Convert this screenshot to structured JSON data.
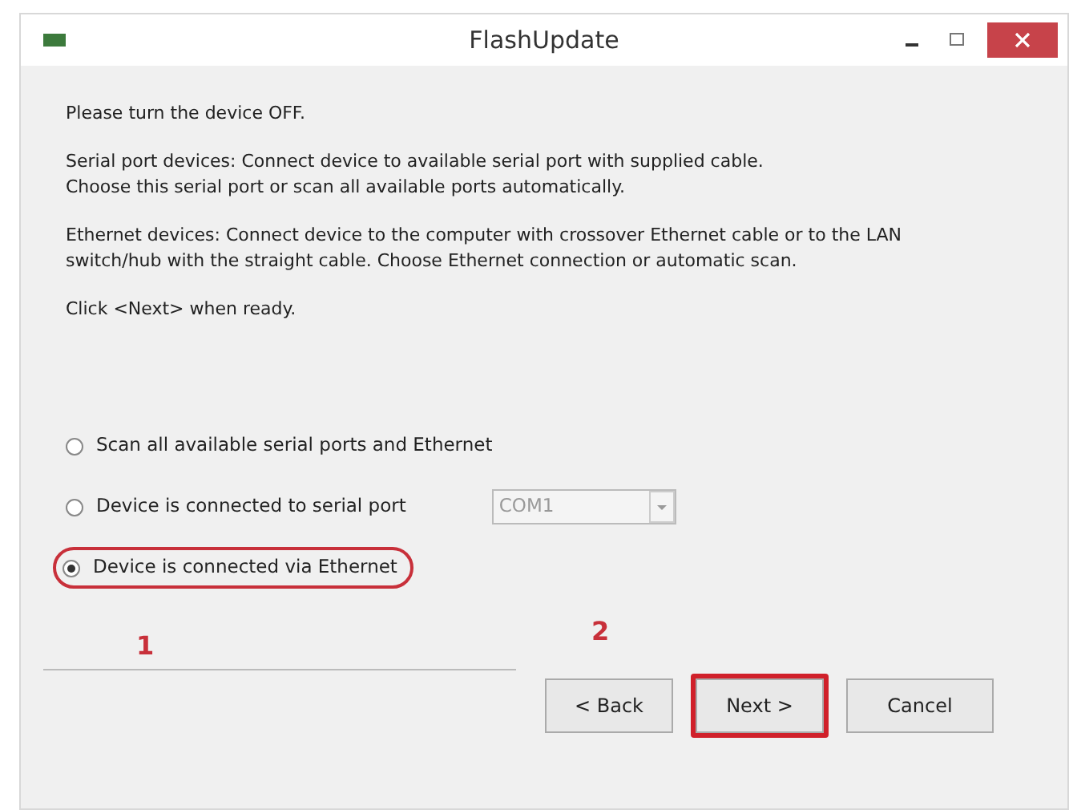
{
  "window": {
    "title": "FlashUpdate"
  },
  "paragraphs": [
    "Please turn the device OFF.",
    "Serial port devices: Connect device to available serial port with supplied cable.\nChoose this serial port or scan all available ports automatically.",
    "Ethernet devices: Connect device to the computer with crossover Ethernet cable or to the LAN\nswitch/hub with the straight cable. Choose Ethernet connection or automatic scan.",
    "Click <Next> when ready."
  ],
  "options": [
    {
      "label": "Scan all available serial ports and Ethernet",
      "selected": false,
      "highlighted": false
    },
    {
      "label": "Device is connected to serial port",
      "selected": false,
      "highlighted": false,
      "port": {
        "value": "COM1",
        "disabled": true
      }
    },
    {
      "label": "Device is connected via Ethernet",
      "selected": true,
      "highlighted": true
    }
  ],
  "step_marks": [
    "1",
    "2"
  ],
  "buttons": [
    {
      "label": "< Back",
      "highlighted": false
    },
    {
      "label": "Next >",
      "highlighted": true
    },
    {
      "label": "Cancel",
      "highlighted": false
    }
  ]
}
